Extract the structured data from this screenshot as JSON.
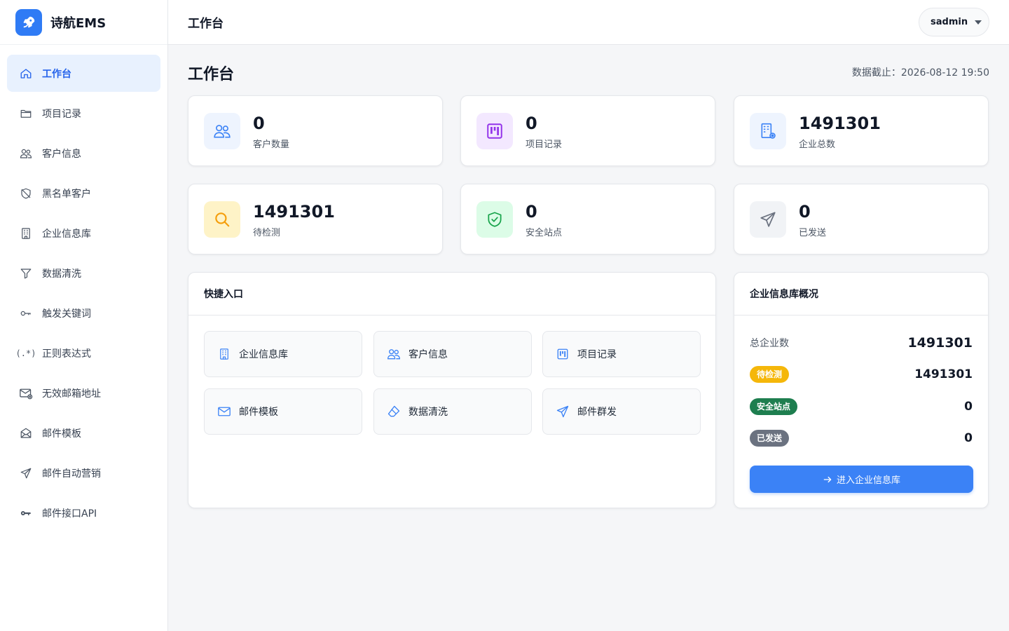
{
  "brand": {
    "name": "诗航EMS"
  },
  "sidebar": {
    "items": [
      {
        "label": "工作台",
        "icon": "home-icon",
        "active": true
      },
      {
        "label": "项目记录",
        "icon": "folder-icon"
      },
      {
        "label": "客户信息",
        "icon": "users-icon"
      },
      {
        "label": "黑名单客户",
        "icon": "shield-slash-icon"
      },
      {
        "label": "企业信息库",
        "icon": "building-icon"
      },
      {
        "label": "数据清洗",
        "icon": "funnel-icon"
      },
      {
        "label": "触发关键词",
        "icon": "key-icon"
      },
      {
        "label": "正则表达式",
        "icon": "regex-icon"
      },
      {
        "label": "无效邮箱地址",
        "icon": "envelope-x-icon"
      },
      {
        "label": "邮件模板",
        "icon": "envelope-open-icon"
      },
      {
        "label": "邮件自动营销",
        "icon": "send-icon"
      },
      {
        "label": "邮件接口API",
        "icon": "key-fill-icon"
      }
    ]
  },
  "topbar": {
    "title": "工作台",
    "user": "sadmin"
  },
  "main": {
    "title": "工作台",
    "data_cutoff": "数据截止：2026-08-12 19:50"
  },
  "stats": [
    {
      "value": "0",
      "label": "客户数量",
      "icon": "users-icon",
      "bg": "#eef4fe",
      "fg": "#3b82f6"
    },
    {
      "value": "0",
      "label": "项目记录",
      "icon": "kanban-icon",
      "bg": "#f3e8ff",
      "fg": "#9333ea"
    },
    {
      "value": "1491301",
      "label": "企业总数",
      "icon": "building-gear-icon",
      "bg": "#eef4fe",
      "fg": "#3b82f6"
    },
    {
      "value": "1491301",
      "label": "待检测",
      "icon": "search-icon",
      "bg": "#fef3c7",
      "fg": "#f59e0b"
    },
    {
      "value": "0",
      "label": "安全站点",
      "icon": "shield-check-icon",
      "bg": "#dcfce7",
      "fg": "#16a34a"
    },
    {
      "value": "0",
      "label": "已发送",
      "icon": "send-icon",
      "bg": "#f1f3f6",
      "fg": "#6b7280"
    }
  ],
  "quick": {
    "title": "快捷入口",
    "items": [
      {
        "label": "企业信息库",
        "icon": "building-icon"
      },
      {
        "label": "客户信息",
        "icon": "users-icon"
      },
      {
        "label": "项目记录",
        "icon": "kanban-icon"
      },
      {
        "label": "邮件模板",
        "icon": "envelope-icon"
      },
      {
        "label": "数据清洗",
        "icon": "eraser-icon"
      },
      {
        "label": "邮件群发",
        "icon": "send-icon"
      }
    ]
  },
  "overview": {
    "title": "企业信息库概况",
    "total_label": "总企业数",
    "total_value": "1491301",
    "rows": [
      {
        "badge": "待检测",
        "value": "1491301",
        "color": "#f5b70a"
      },
      {
        "badge": "安全站点",
        "value": "0",
        "color": "#1e7e4f"
      },
      {
        "badge": "已发送",
        "value": "0",
        "color": "#6b7280"
      }
    ],
    "button_label": "进入企业信息库"
  }
}
